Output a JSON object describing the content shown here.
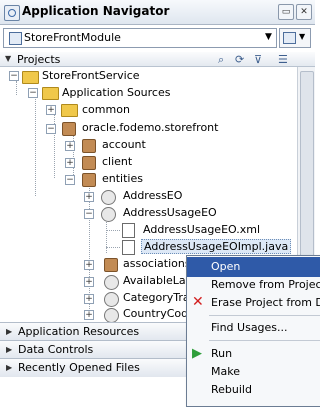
{
  "window": {
    "title": "Application Navigator"
  },
  "module": {
    "name": "StoreFrontModule"
  },
  "projects_header": {
    "label": "Projects"
  },
  "tree": {
    "project": "StoreFrontService",
    "app_sources": "Application Sources",
    "common": "common",
    "storefront": "oracle.fodemo.storefront",
    "account": "account",
    "client": "client",
    "entities": "entities",
    "address_eo": "AddressEO",
    "address_usage_eo": "AddressUsageEO",
    "address_usage_xml": "AddressUsageEO.xml",
    "address_usage_impl": "AddressUsageEOImpl.java",
    "associations": "associations",
    "available": "AvailableLan",
    "category": "CategoryTra",
    "country": "CountryCode"
  },
  "bottom_panels": {
    "app_resources": "Application Resources",
    "data_controls": "Data Controls",
    "recent_files": "Recently Opened Files"
  },
  "context_menu": {
    "open": "Open",
    "remove": "Remove from Project",
    "erase": "Erase Project from Dis",
    "find_usages": "Find Usages...",
    "run": "Run",
    "make": "Make",
    "rebuild": "Rebuild"
  },
  "colors": {
    "menu_highlight": "#2f5aa8",
    "run_green": "#2f9e3a",
    "erase_red": "#d21e1e"
  }
}
